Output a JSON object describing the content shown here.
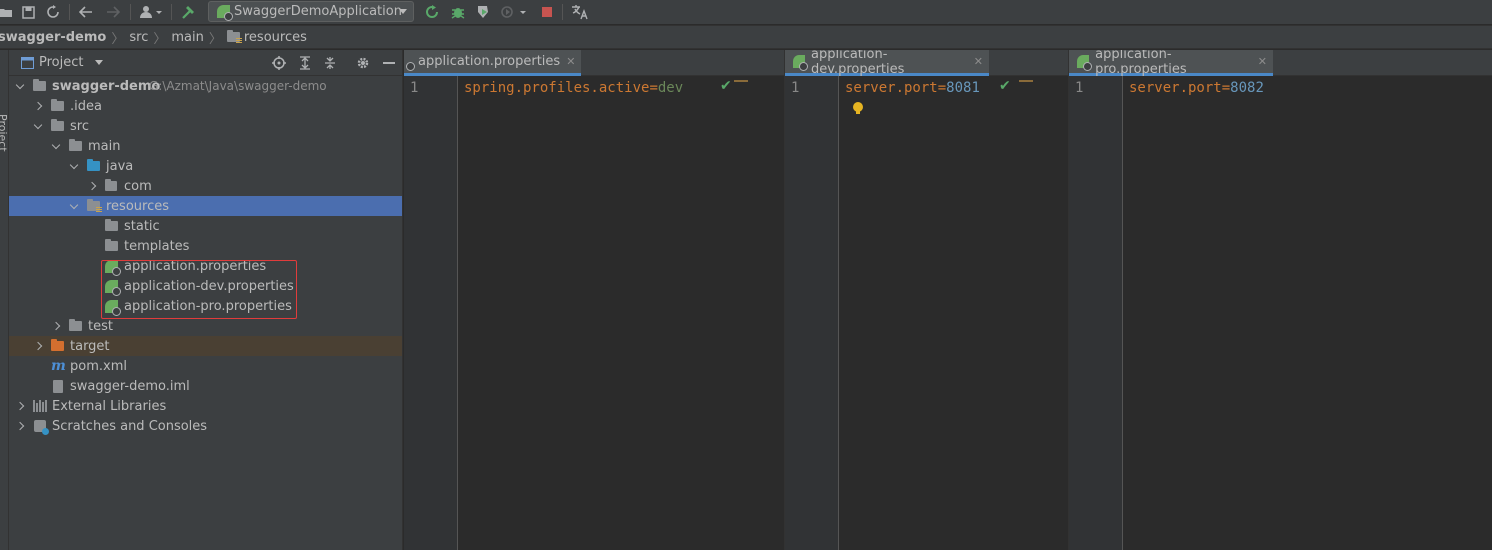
{
  "toolbar": {
    "run_config": "SwaggerDemoApplication"
  },
  "breadcrumb": {
    "items": [
      "swagger-demo",
      "src",
      "main",
      "resources"
    ]
  },
  "left_stripe": {
    "label": "Project"
  },
  "project_panel": {
    "title": "Project",
    "tree": [
      {
        "label": "swagger-demo",
        "hint": "G:\\Azmat\\Java\\swagger-demo"
      },
      {
        "label": ".idea"
      },
      {
        "label": "src"
      },
      {
        "label": "main"
      },
      {
        "label": "java"
      },
      {
        "label": "com"
      },
      {
        "label": "resources"
      },
      {
        "label": "static"
      },
      {
        "label": "templates"
      },
      {
        "label": "application.properties"
      },
      {
        "label": "application-dev.properties"
      },
      {
        "label": "application-pro.properties"
      },
      {
        "label": "test"
      },
      {
        "label": "target"
      },
      {
        "label": "pom.xml"
      },
      {
        "label": "swagger-demo.iml"
      },
      {
        "label": "External Libraries"
      },
      {
        "label": "Scratches and Consoles"
      }
    ]
  },
  "editors": [
    {
      "tab": "application.properties",
      "line_number": "1",
      "key": "spring.profiles.active",
      "eq": "=",
      "value": "dev"
    },
    {
      "tab": "application-dev.properties",
      "line_number": "1",
      "key": "server.port",
      "eq": "=",
      "value": "8081"
    },
    {
      "tab": "application-pro.properties",
      "line_number": "1",
      "key": "server.port",
      "eq": "=",
      "value": "8082"
    }
  ],
  "colors": {
    "selection": "#4b6eaf",
    "highlight_box": "#e03c3c",
    "key": "#cc7832",
    "string_value": "#6a8759",
    "number_value": "#6897bb"
  }
}
